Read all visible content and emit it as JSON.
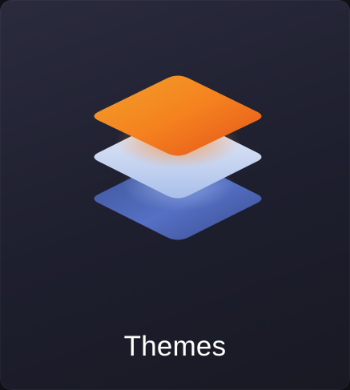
{
  "app_tile": {
    "label": "Themes",
    "icon": "stacked-layers-icon",
    "colors": {
      "background": "#1f2030",
      "top_layer": "#f5821f",
      "middle_layer": "#c9d6f0",
      "bottom_layer": "#4a5fb0",
      "label": "#ffffff"
    }
  }
}
